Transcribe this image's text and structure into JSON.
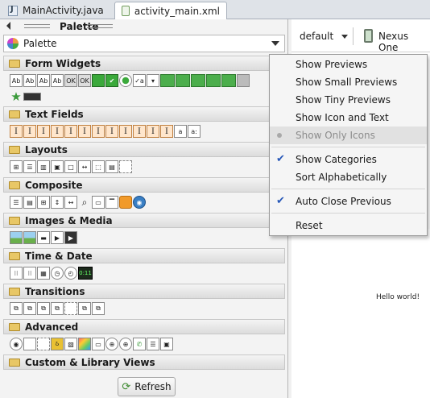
{
  "tabs": [
    {
      "label": "MainActivity.java",
      "icon": "java-file-icon"
    },
    {
      "label": "activity_main.xml",
      "icon": "xml-file-icon"
    }
  ],
  "palette": {
    "title": "Palette",
    "selector_label": "Palette",
    "categories": [
      "Form Widgets",
      "Text Fields",
      "Layouts",
      "Composite",
      "Images & Media",
      "Time & Date",
      "Transitions",
      "Advanced",
      "Custom & Library Views"
    ],
    "form_widgets_labels": [
      "Ab",
      "Ab",
      "Ab",
      "Ab",
      "OK",
      "OK"
    ],
    "text_fields_labels": [
      "I",
      "I",
      "I",
      "I",
      "I",
      "I",
      "I",
      "I",
      "I",
      "I",
      "I",
      "I",
      "a",
      "a:"
    ],
    "refresh_label": "Refresh"
  },
  "editor": {
    "theme": "default",
    "device": "Nexus One",
    "canvas_text": "Hello world!"
  },
  "menu": {
    "items": [
      {
        "label": "Show Previews",
        "checked": false,
        "disabled": false
      },
      {
        "label": "Show Small Previews",
        "checked": false,
        "disabled": false
      },
      {
        "label": "Show Tiny Previews",
        "checked": false,
        "disabled": false
      },
      {
        "label": "Show Icon and Text",
        "checked": false,
        "disabled": false
      },
      {
        "label": "Show Only Icons",
        "checked": false,
        "disabled": true
      },
      {
        "label": "Show Categories",
        "checked": true,
        "disabled": false
      },
      {
        "label": "Sort Alphabetically",
        "checked": false,
        "disabled": false
      },
      {
        "label": "Auto Close Previous",
        "checked": true,
        "disabled": false
      },
      {
        "label": "Reset",
        "checked": false,
        "disabled": false
      }
    ]
  },
  "colors": {
    "check": "#2657b8",
    "disabled_bg": "#e1e1e1",
    "widget_green": "#3ba93b",
    "textfield_orange": "#ffe6cc"
  }
}
